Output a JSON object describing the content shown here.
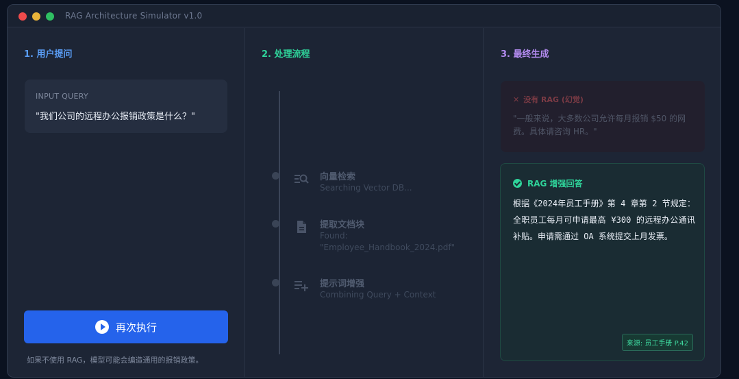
{
  "window": {
    "title": "RAG Architecture Simulator v1.0"
  },
  "colors": {
    "accent_blue": "#2563eb",
    "accent_green": "#2fd39a",
    "accent_purple": "#b38bf0",
    "error_red": "#7a3a44"
  },
  "column1": {
    "heading": "1. 用户提问",
    "query_label": "INPUT QUERY",
    "query_text": "\"我们公司的远程办公报销政策是什么？\"",
    "rerun_button": "再次执行",
    "footnote": "如果不使用 RAG，模型可能会编造通用的报销政策。"
  },
  "column2": {
    "heading": "2. 处理流程",
    "steps": [
      {
        "icon": "vector-search-icon",
        "title": "向量检索",
        "subtitle": "Searching Vector DB..."
      },
      {
        "icon": "document-icon",
        "title": "提取文档块",
        "subtitle_line1": "Found:",
        "subtitle_line2": "\"Employee_Handbook_2024.pdf\""
      },
      {
        "icon": "playlist-add-icon",
        "title": "提示词增强",
        "subtitle": "Combining Query + Context"
      }
    ]
  },
  "column3": {
    "heading": "3. 最终生成",
    "no_rag": {
      "title": "没有 RAG (幻觉)",
      "text": "\"一般来说，大多数公司允许每月报销 $50 的网费。具体请咨询 HR。\""
    },
    "rag": {
      "title": "RAG 增强回答",
      "text": "根据《2024年员工手册》第 4 章第 2 节规定：全职员工每月可申请最高 ¥300 的远程办公通讯补贴。申请需通过 OA 系统提交上月发票。",
      "source": "来源: 员工手册 P.42"
    }
  }
}
